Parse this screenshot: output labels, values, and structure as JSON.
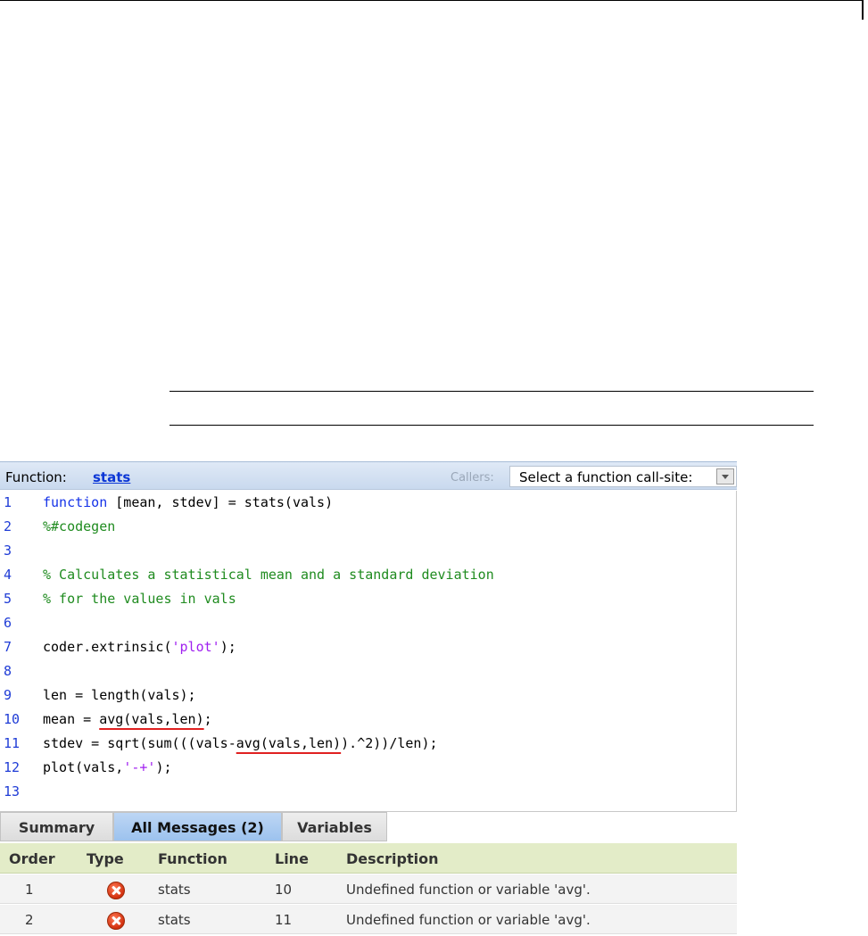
{
  "header": {
    "function_label": "Function:",
    "function_name": "stats",
    "callers_label": "Callers:",
    "callsite_select_value": "Select a function call-site:"
  },
  "code": {
    "lines": [
      {
        "num": "1",
        "text": "function [mean, stdev] = stats(vals)"
      },
      {
        "num": "2",
        "text": "%#codegen"
      },
      {
        "num": "3",
        "text": ""
      },
      {
        "num": "4",
        "text": "% Calculates a statistical mean and a standard deviation"
      },
      {
        "num": "5",
        "text": "% for the values in vals"
      },
      {
        "num": "6",
        "text": ""
      },
      {
        "num": "7",
        "text": "coder.extrinsic('plot');"
      },
      {
        "num": "8",
        "text": ""
      },
      {
        "num": "9",
        "text": "len = length(vals);"
      },
      {
        "num": "10",
        "text": "mean = avg(vals,len);"
      },
      {
        "num": "11",
        "text": "stdev = sqrt(sum(((vals-avg(vals,len)).^2))/len);"
      },
      {
        "num": "12",
        "text": "plot(vals,'-+');"
      },
      {
        "num": "13",
        "text": ""
      }
    ],
    "tokens": {
      "l1_kw": "function",
      "l1_rest": " [mean, stdev] = stats(vals)",
      "l2": "%#codegen",
      "l4": "% Calculates a statistical mean and a standard deviation",
      "l5": "% for the values in vals",
      "l7_a": "coder.extrinsic(",
      "l7_str": "'plot'",
      "l7_b": ");",
      "l9": "len = length(vals);",
      "l10_a": "mean = ",
      "l10_err": "avg(vals,len)",
      "l10_b": ";",
      "l11_a": "stdev = sqrt(sum(((vals-",
      "l11_err": "avg(vals,len)",
      "l11_b": ").^2))/len);",
      "l12_a": "plot(vals,",
      "l12_str": "'-+'",
      "l12_b": ");"
    }
  },
  "tabs": [
    {
      "label": "Summary"
    },
    {
      "label": "All Messages (2)"
    },
    {
      "label": "Variables"
    }
  ],
  "messages": {
    "columns": [
      "Order",
      "Type",
      "Function",
      "Line",
      "Description"
    ],
    "rows": [
      {
        "order": "1",
        "type_icon": "error-icon",
        "function": "stats",
        "line": "10",
        "description": "Undefined function or variable 'avg'."
      },
      {
        "order": "2",
        "type_icon": "error-icon",
        "function": "stats",
        "line": "11",
        "description": "Undefined function or variable 'avg'."
      }
    ]
  },
  "colors": {
    "keyword": "#1432e8",
    "comment": "#1f8b1f",
    "string": "#a020f0",
    "error_underline": "#e02020",
    "active_tab": "#9cc2ee",
    "table_header": "#e3ecc8"
  }
}
